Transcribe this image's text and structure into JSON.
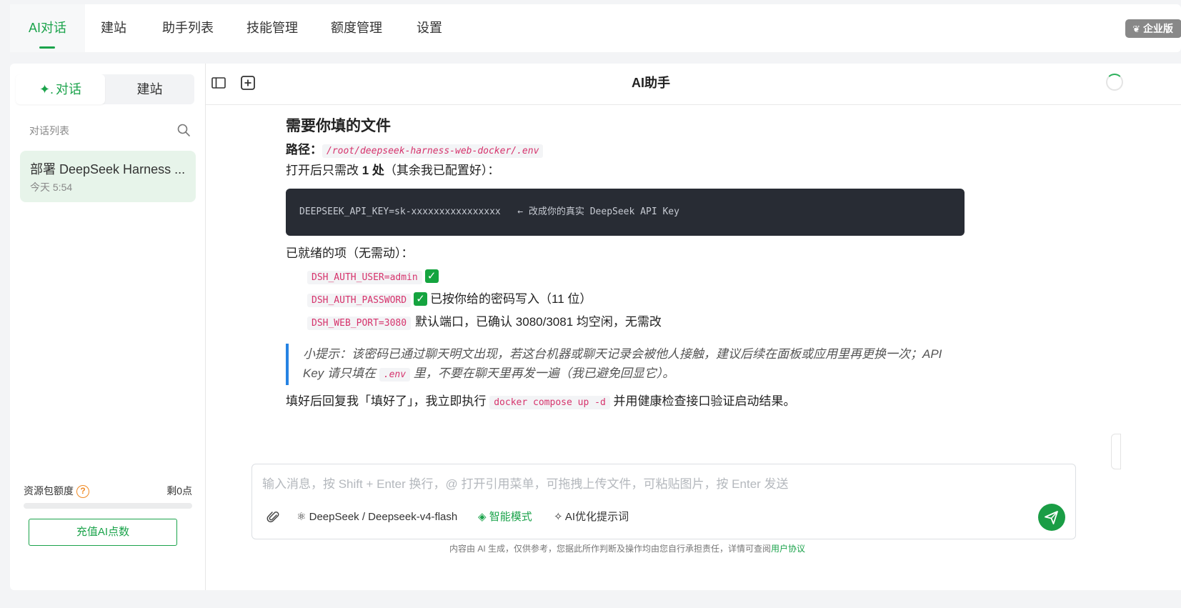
{
  "nav": {
    "tabs": [
      "AI对话",
      "建站",
      "助手列表",
      "技能管理",
      "额度管理",
      "设置"
    ],
    "enterprise_label": "企业版"
  },
  "sidebar": {
    "segment": [
      "对话",
      "建站"
    ],
    "list_label": "对话列表",
    "conversation": {
      "title": "部署 DeepSeek Harness ...",
      "time": "今天 5:54"
    },
    "quota_label": "资源包额度",
    "quota_help": "?",
    "quota_remaining": "剩0点",
    "quota_fraction": 0,
    "recharge_label": "充值AI点数"
  },
  "header": {
    "title": "AI助手"
  },
  "message": {
    "heading": "需要你填的文件",
    "path_label": "路径：",
    "path_value": "/root/deepseek-harness-web-docker/.env",
    "edit_prefix": "打开后只需改 ",
    "edit_bold": "1 处",
    "edit_suffix": "（其余我已配置好）：",
    "code_line": "DEEPSEEK_API_KEY=sk-xxxxxxxxxxxxxxxx   ← 改成你的真实 DeepSeek API Key",
    "ready_label": "已就绪的项（无需动）：",
    "items": [
      {
        "code": "DSH_AUTH_USER=admin",
        "check": "✓",
        "note": ""
      },
      {
        "code": "DSH_AUTH_PASSWORD",
        "check": "✓",
        "note": "已按你给的密码写入（11 位）"
      },
      {
        "code": "DSH_WEB_PORT=3080",
        "check": "",
        "note": "默认端口，已确认 3080/3081 均空闲，无需改"
      }
    ],
    "tip_part1": "小提示：该密码已通过聊天明文出现，若这台机器或聊天记录会被他人接触，建议后续在面板或应用里再更换一次；API Key 请只填在 ",
    "tip_code": ".env",
    "tip_part2": " 里，不要在聊天里再发一遍（我已避免回显它）。",
    "final_prefix": "填好后回复我「填好了」，我立即执行 ",
    "final_code": "docker compose up -d",
    "final_suffix": " 并用健康检查接口验证启动结果。"
  },
  "composer": {
    "placeholder": "输入消息，按 Shift + Enter 换行，@ 打开引用菜单，可拖拽上传文件，可粘贴图片，按 Enter 发送",
    "model": "DeepSeek / Deepseek-v4-flash",
    "mode": "智能模式",
    "optimize": "AI优化提示词"
  },
  "disclaimer": {
    "text": "内容由 AI 生成，仅供参考，您据此所作判断及操作均由您自行承担责任，详情可查阅",
    "link": "用户协议"
  },
  "colors": {
    "accent": "#1ba34b",
    "code_bg": "#282c34",
    "tip_border": "#2683e3",
    "inline_code": "#d6336c"
  }
}
